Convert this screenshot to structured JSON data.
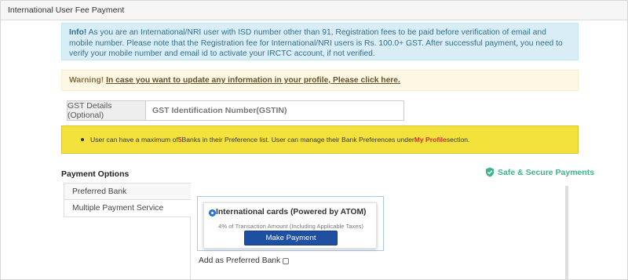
{
  "panel": {
    "title": "International User Fee Payment"
  },
  "info": {
    "label": "Info!",
    "text": " As you are an International/NRI user with ISD number other than 91, Registration fees to be paid before verification of email and mobile number. Please note that the Registration fee for International/NRI users is Rs. 100.0+ GST. After successful payment, you need to verify your mobile number and email id to activate your IRCTC account, if not verified."
  },
  "warning": {
    "label": "Warning!",
    "link_text": "In case you want to update any information in your profile, Please click here."
  },
  "gst": {
    "addon_label": "GST Details (Optional)",
    "placeholder": "GST Identification Number(GSTIN)",
    "value": ""
  },
  "bank_notice": {
    "prefix": "User can have a maximum of ",
    "count": "5",
    "middle": " Banks in their Preference list. User can manage their Bank Preferences under ",
    "link": "My Profile",
    "suffix": " section."
  },
  "payment": {
    "heading": "Payment Options",
    "secure_label": "Safe & Secure Payments",
    "tabs": [
      {
        "label": "Preferred Bank"
      },
      {
        "label": "Multiple Payment Service"
      }
    ],
    "active_tab": "Multiple Payment Service",
    "card": {
      "title": "International cards (Powered by ATOM)",
      "subtitle": "4% of Transaction Amount (Including Applicable Taxes)",
      "button": "Make Payment",
      "selected": true
    },
    "preferred_bank_label": "Add as Preferred Bank"
  },
  "colors": {
    "info_bg": "#d9edf7",
    "warning_bg": "#fcf8e3",
    "notice_bg": "#f4e23c",
    "secure_green": "#3cb58c",
    "button_blue": "#1e4fa0"
  }
}
